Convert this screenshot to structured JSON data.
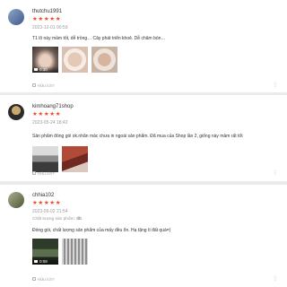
{
  "reviews": [
    {
      "username": "thutchu1991",
      "stars": "★★★★★",
      "date": "2023-12-01 00:59",
      "comment": "T1 lô này mầm tốt, dễ trồng… Cây phát triển khoẻ. Dễ chăm bón…",
      "media": [
        {
          "type": "video",
          "duration": "0:30"
        },
        {
          "type": "image"
        },
        {
          "type": "image"
        }
      ],
      "like_label": "Hữu ích?"
    },
    {
      "username": "kimhoang71shop",
      "stars": "★★★★★",
      "date": "2023-05-24 18:42",
      "comment": "Sản phẩm đóng gói ok.nhãn mác chưa in ngoài sản phẩm. Đã mua của Shop lần 2, giống này mầm rất tốt",
      "media": [
        {
          "type": "image"
        },
        {
          "type": "image"
        }
      ],
      "like_label": "Hữu ích?"
    },
    {
      "username": "chhia102",
      "stars": "★★★★★",
      "date": "2023-06-02 21:54",
      "attr_label": "Chất lượng sản phẩm:",
      "attr_value": "tốt",
      "comment": "Đóng gói, chất lượng sản phẩm của mấy đều ổn. Hạ tặng ít đất quá=)",
      "media": [
        {
          "type": "video",
          "duration": "0:08"
        },
        {
          "type": "image"
        }
      ],
      "like_label": "Hữu ích?"
    }
  ],
  "icons": {
    "star": "star-icon",
    "like": "like-icon",
    "more": "more-vertical-icon",
    "video": "camera-icon"
  },
  "colors": {
    "star": "#ee4d2d",
    "background": "#ebebeb",
    "card": "#ffffff"
  }
}
